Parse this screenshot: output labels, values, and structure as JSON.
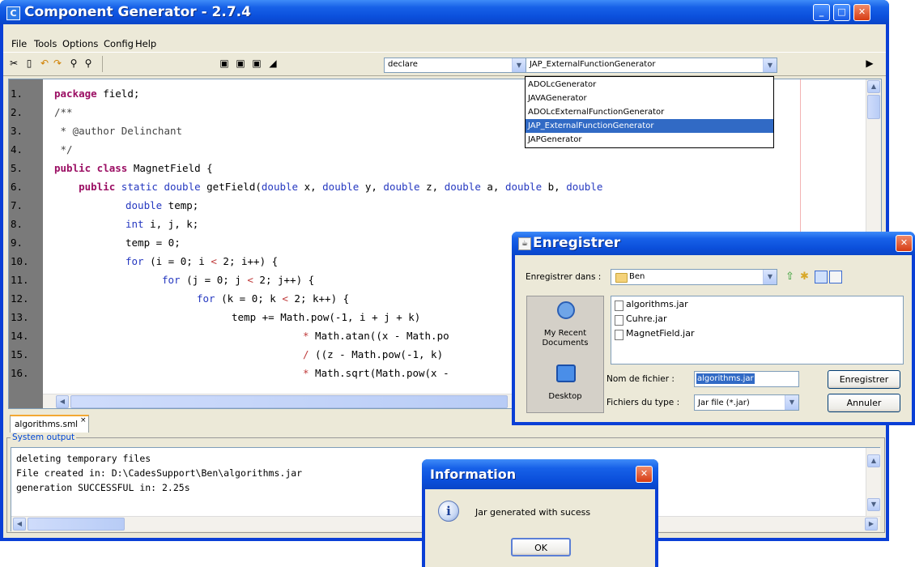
{
  "window": {
    "title": "Component Generator - 2.7.4",
    "app_icon_glyph": "C"
  },
  "menu": [
    "File",
    "Tools",
    "Options",
    "Config",
    "Help"
  ],
  "toolbar": {
    "icons": [
      "cut-icon",
      "new-file-icon",
      "undo-icon",
      "redo-icon",
      "find-icon",
      "find-replace-icon",
      "save-icon",
      "save-as-icon",
      "save-all-icon",
      "eraser-icon",
      "run-icon"
    ],
    "left_combo_value": "declare",
    "generator_combo_value": "JAP_ExternalFunctionGenerator"
  },
  "generator_options": [
    "ADOLcGenerator",
    "JAVAGenerator",
    "ADOLcExternalFunctionGenerator",
    "JAP_ExternalFunctionGenerator",
    "JAPGenerator"
  ],
  "editor": {
    "line_numbers": [
      "1.",
      "2.",
      "3.",
      "4.",
      "5.",
      "6.",
      "7.",
      "8.",
      "9.",
      "10.",
      "11.",
      "12.",
      "13.",
      "14.",
      "15.",
      "16."
    ],
    "code": {
      "l1_kw": "package",
      "l1_rest": " field;",
      "l2": "/**",
      "l3": " * @author Delinchant",
      "l4": " */",
      "l5_kw": "public class",
      "l5_rest": " MagnetField {",
      "l6_a": "    ",
      "l6_kw": "public",
      "l6_b": " static double",
      "l6_c": " getField(",
      "l6_d": "double",
      "l6_e": " x, ",
      "l6_f": "double",
      "l6_g": " y, ",
      "l6_h": "double",
      "l6_i": " z, ",
      "l6_j": "double",
      "l6_k": " a, ",
      "l6_l": "double",
      "l6_m": " b, ",
      "l6_n": "double",
      "l7_ty": "double",
      "l7_rest": " temp;",
      "l8_ty": "int",
      "l8_rest": " i, j, k;",
      "l9": "temp = 0;",
      "l10_kw": "for",
      "l10_a": " (i = 0; i ",
      "l10_op": "<",
      "l10_b": " 2; i++) {",
      "l11_kw": "for",
      "l11_a": " (j = 0; j ",
      "l11_op": "<",
      "l11_b": " 2; j++) {",
      "l12_kw": "for",
      "l12_a": " (k = 0; k ",
      "l12_op": "<",
      "l12_b": " 2; k++) {",
      "l13": "temp += Math.pow(-1, i + j + k)",
      "l14_op": "*",
      "l14_rest": " Math.atan((x - Math.po",
      "l15_op": "/",
      "l15_rest": " ((z - Math.pow(-1, k)",
      "l16_op": "*",
      "l16_rest": " Math.sqrt(Math.pow(x -"
    }
  },
  "file_tab": {
    "label": "algorithms.sml",
    "close": "×"
  },
  "output": {
    "title": "System output",
    "lines": [
      "deleting temporary files",
      "File created in: D:\\CadesSupport\\Ben\\algorithms.jar",
      "generation SUCCESSFUL in: 2.25s"
    ]
  },
  "save_dialog": {
    "title": "Enregistrer",
    "look_in_label": "Enregistrer dans :",
    "look_in_value": "Ben",
    "places": [
      "My Recent Documents",
      "Desktop"
    ],
    "files": [
      "algorithms.jar",
      "Cuhre.jar",
      "MagnetField.jar"
    ],
    "filename_label": "Nom de fichier :",
    "filename_value": "algorithms.jar",
    "filetype_label": "Fichiers du type :",
    "filetype_value": "Jar file (*.jar)",
    "save_button": "Enregistrer",
    "cancel_button": "Annuler"
  },
  "info_dialog": {
    "title": "Information",
    "message": "Jar generated with sucess",
    "ok_button": "OK"
  },
  "colors": {
    "title_bar": "#0a45c8",
    "keyword": "#9b0e63",
    "type": "#2538c0",
    "selection": "#316ac5"
  }
}
